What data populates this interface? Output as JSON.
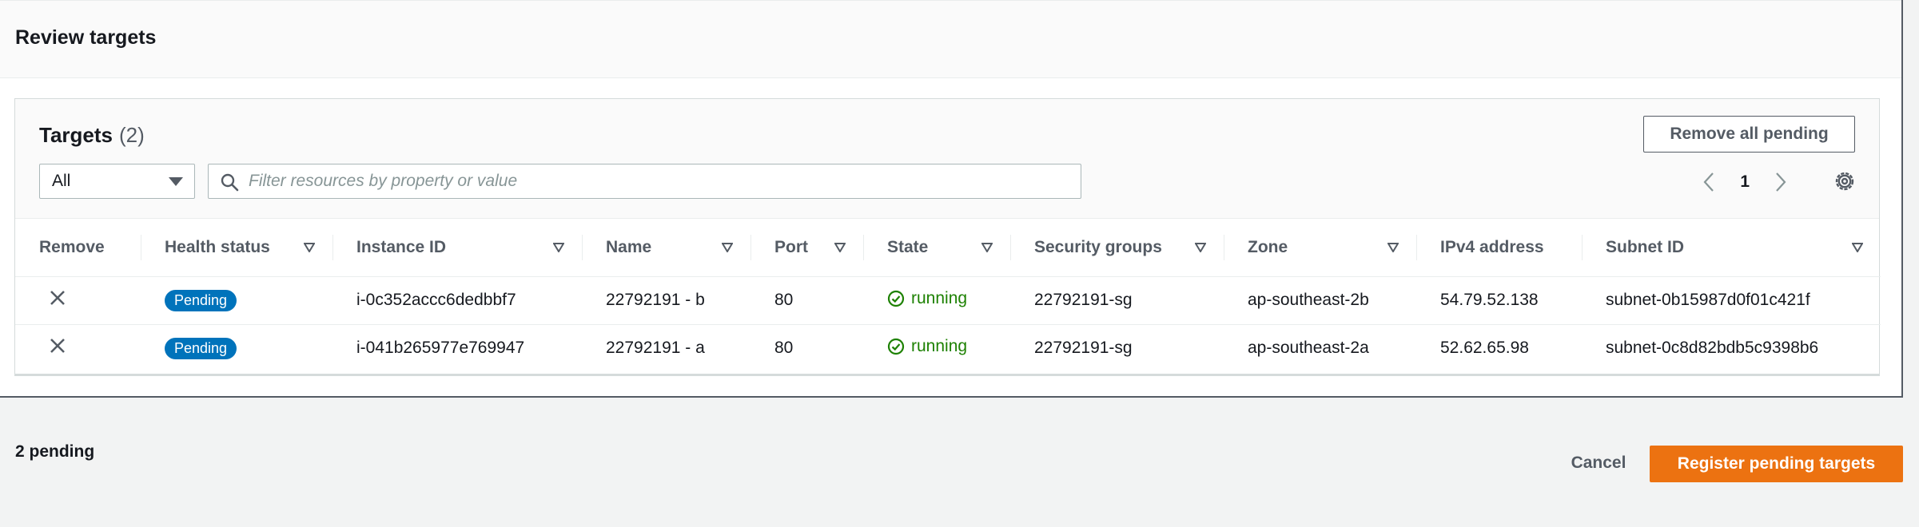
{
  "review": {
    "title": "Review targets"
  },
  "targets": {
    "title": "Targets",
    "count": "(2)",
    "remove_all_label": "Remove all pending",
    "filter": {
      "selected": "All"
    },
    "search": {
      "placeholder": "Filter resources by property or value",
      "value": ""
    },
    "pagination": {
      "current_page": "1"
    },
    "columns": [
      "Remove",
      "Health status",
      "Instance ID",
      "Name",
      "Port",
      "State",
      "Security groups",
      "Zone",
      "IPv4 address",
      "Subnet ID"
    ],
    "rows": [
      {
        "health_status": "Pending",
        "instance_id": "i-0c352accc6dedbbf7",
        "name": "22792191 - b",
        "port": "80",
        "state": "running",
        "security_groups": "22792191-sg",
        "zone": "ap-southeast-2b",
        "ipv4": "54.79.52.138",
        "subnet_id": "subnet-0b15987d0f01c421f"
      },
      {
        "health_status": "Pending",
        "instance_id": "i-041b265977e769947",
        "name": "22792191 - a",
        "port": "80",
        "state": "running",
        "security_groups": "22792191-sg",
        "zone": "ap-southeast-2a",
        "ipv4": "52.62.65.98",
        "subnet_id": "subnet-0c8d82bdb5c9398b6"
      }
    ]
  },
  "footer": {
    "pending_summary": "2 pending",
    "cancel_label": "Cancel",
    "register_label": "Register pending targets"
  },
  "icons": {
    "search": "search-icon",
    "caret": "caret-down-icon",
    "sort": "sort-down-icon",
    "prev": "chevron-left-icon",
    "next": "chevron-right-icon",
    "settings": "gear-icon",
    "remove": "close-icon",
    "running": "check-circle-icon"
  },
  "colors": {
    "primary_action": "#ec7211",
    "badge": "#0073bb",
    "running": "#1d8102"
  }
}
